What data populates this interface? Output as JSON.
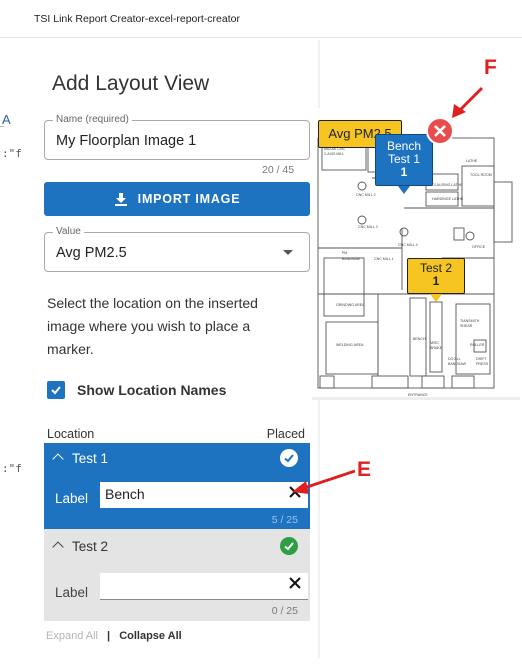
{
  "window": {
    "title": "TSI Link Report Creator-excel-report-creator"
  },
  "background_peek": {
    "text_a": "A",
    "text_b": ":\"f",
    "text_c": ":\"f"
  },
  "dialog": {
    "title": "Add Layout View",
    "name_field": {
      "label": "Name (required)",
      "value": "My Floorplan Image 1",
      "counter": "20 / 45"
    },
    "import_button": {
      "label": "IMPORT IMAGE",
      "icon": "download-icon"
    },
    "value_select": {
      "label": "Value",
      "selected": "Avg PM2.5"
    },
    "instructions": "Select the location on the inserted image where you wish to place a marker.",
    "show_location_names": {
      "label": "Show Location Names",
      "checked": true
    },
    "locations": {
      "header_location": "Location",
      "header_placed": "Placed",
      "items": [
        {
          "name": "Test 1",
          "label_caption": "Label",
          "label_value": "Bench",
          "counter": "5 / 25",
          "placed": true,
          "expanded": true,
          "status": "check-circle-outline-icon"
        },
        {
          "name": "Test 2",
          "label_caption": "Label",
          "label_value": "",
          "counter": "0 / 25",
          "placed": true,
          "expanded": true,
          "status": "check-circle-filled-icon"
        }
      ]
    },
    "footer": {
      "expand_all": "Expand All",
      "separator": "|",
      "collapse_all": "Collapse All"
    }
  },
  "floorplan": {
    "room_labels": [
      "MAZAK CNC 2-AXIS MILL",
      "LATHE",
      "CNC MILL 2",
      "CLAUSING LATHE",
      "TOOL ROOM",
      "HARDINGE LATHE",
      "CNC MILL 3",
      "OFFICE",
      "CNC MILL 4",
      "PM BANDSAW",
      "CNC MILL 1",
      "GRINDING AREA",
      "TIANSMITH SHEAR",
      "WELDING AREA",
      "BENCH",
      "MISC BRAKE",
      "ROLLER",
      "DO ALL BANDSAW",
      "DRIFT PRESS",
      "ENTRANCE"
    ],
    "markers": [
      {
        "label": "Avg PM2.5",
        "color": "#f6c522"
      },
      {
        "line1": "Bench",
        "line2": "Test 1",
        "line3": "1",
        "color": "#1e73c0"
      },
      {
        "line1": "Test 2",
        "line2": "1",
        "color": "#f6c522"
      }
    ]
  },
  "annotations": [
    {
      "letter": "F",
      "color": "#e02020"
    },
    {
      "letter": "E",
      "color": "#e02020"
    }
  ],
  "colors": {
    "accent": "#1e73c0",
    "annotation": "#e02020",
    "success": "#2e9e44",
    "marker_yellow": "#f6c522"
  }
}
